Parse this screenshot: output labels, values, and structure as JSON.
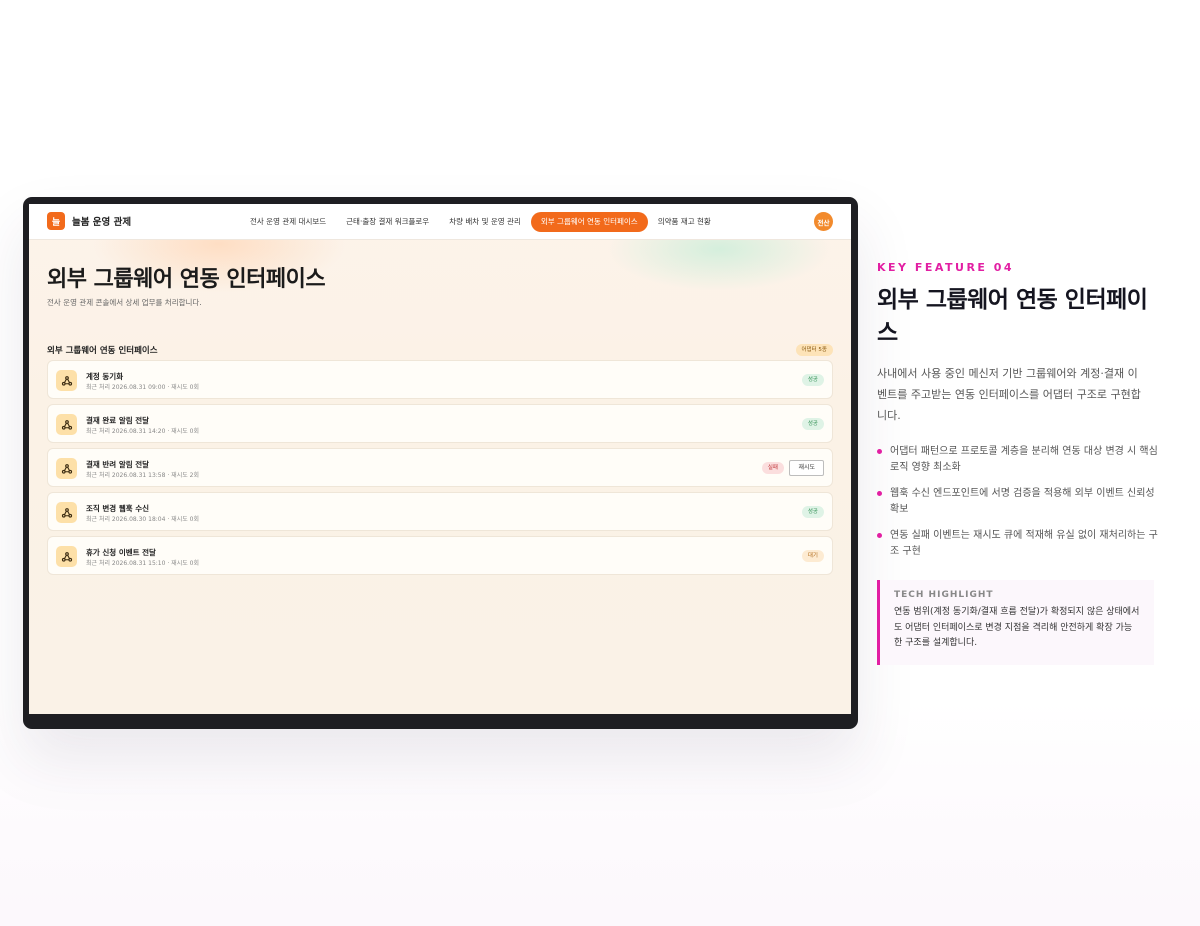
{
  "app": {
    "brand_logo": "늘",
    "brand_name": "늘봄 운영 관제",
    "avatar": "전산"
  },
  "nav": {
    "items": [
      {
        "label": "전사 운영 관제 대시보드",
        "active": false
      },
      {
        "label": "근태·출장 결재 워크플로우",
        "active": false
      },
      {
        "label": "차량 배차 및 운영 관리",
        "active": false
      },
      {
        "label": "외부 그룹웨어 연동 인터페이스",
        "active": true
      },
      {
        "label": "의약품 재고 현황",
        "active": false
      }
    ]
  },
  "page": {
    "title": "외부 그룹웨어 연동 인터페이스",
    "subtitle": "전사 운영 관제 콘솔에서 상세 업무를 처리합니다."
  },
  "section": {
    "title": "외부 그룹웨어 연동 인터페이스",
    "count_badge": "어댑터 5종"
  },
  "adapters": [
    {
      "name": "계정 동기화",
      "meta": "최근 처리 2026.08.31 09:00 · 재시도 0회",
      "status": "성공",
      "status_type": "ok",
      "icon": "webhook-icon"
    },
    {
      "name": "결재 완료 알림 전달",
      "meta": "최근 처리 2026.08.31 14:20 · 재시도 0회",
      "status": "성공",
      "status_type": "ok",
      "icon": "webhook-icon"
    },
    {
      "name": "결재 반려 알림 전달",
      "meta": "최근 처리 2026.08.31 13:58 · 재시도 2회",
      "status": "실패",
      "status_type": "fail",
      "retry_label": "재시도",
      "icon": "webhook-icon"
    },
    {
      "name": "조직 변경 웹훅 수신",
      "meta": "최근 처리 2026.08.30 18:04 · 재시도 0회",
      "status": "성공",
      "status_type": "ok",
      "icon": "webhook-icon"
    },
    {
      "name": "휴가 신청 이벤트 전달",
      "meta": "최근 처리 2026.08.31 15:10 · 재시도 0회",
      "status": "대기",
      "status_type": "wait",
      "icon": "webhook-icon"
    }
  ],
  "feature": {
    "label": "KEY FEATURE 04",
    "title": "외부 그룹웨어 연동 인터페이스",
    "description": "사내에서 사용 중인 메신저 기반 그룹웨어와 계정·결재 이벤트를 주고받는 연동 인터페이스를 어댑터 구조로 구현합니다.",
    "bullets": [
      "어댑터 패턴으로 프로토콜 계층을 분리해 연동 대상 변경 시 핵심 로직 영향 최소화",
      "웹훅 수신 엔드포인트에 서명 검증을 적용해 외부 이벤트 신뢰성 확보",
      "연동 실패 이벤트는 재시도 큐에 적재해 유실 없이 재처리하는 구조 구현"
    ],
    "tech_label": "TECH HIGHLIGHT",
    "tech_text": "연동 범위(계정 동기화/결재 흐름 전달)가 확정되지 않은 상태에서도 어댑터 인터페이스로 변경 지점을 격리해 안전하게 확장 가능한 구조를 설계합니다."
  },
  "colors": {
    "accent": "#f26a1b",
    "feature_accent": "#e21fa3"
  }
}
